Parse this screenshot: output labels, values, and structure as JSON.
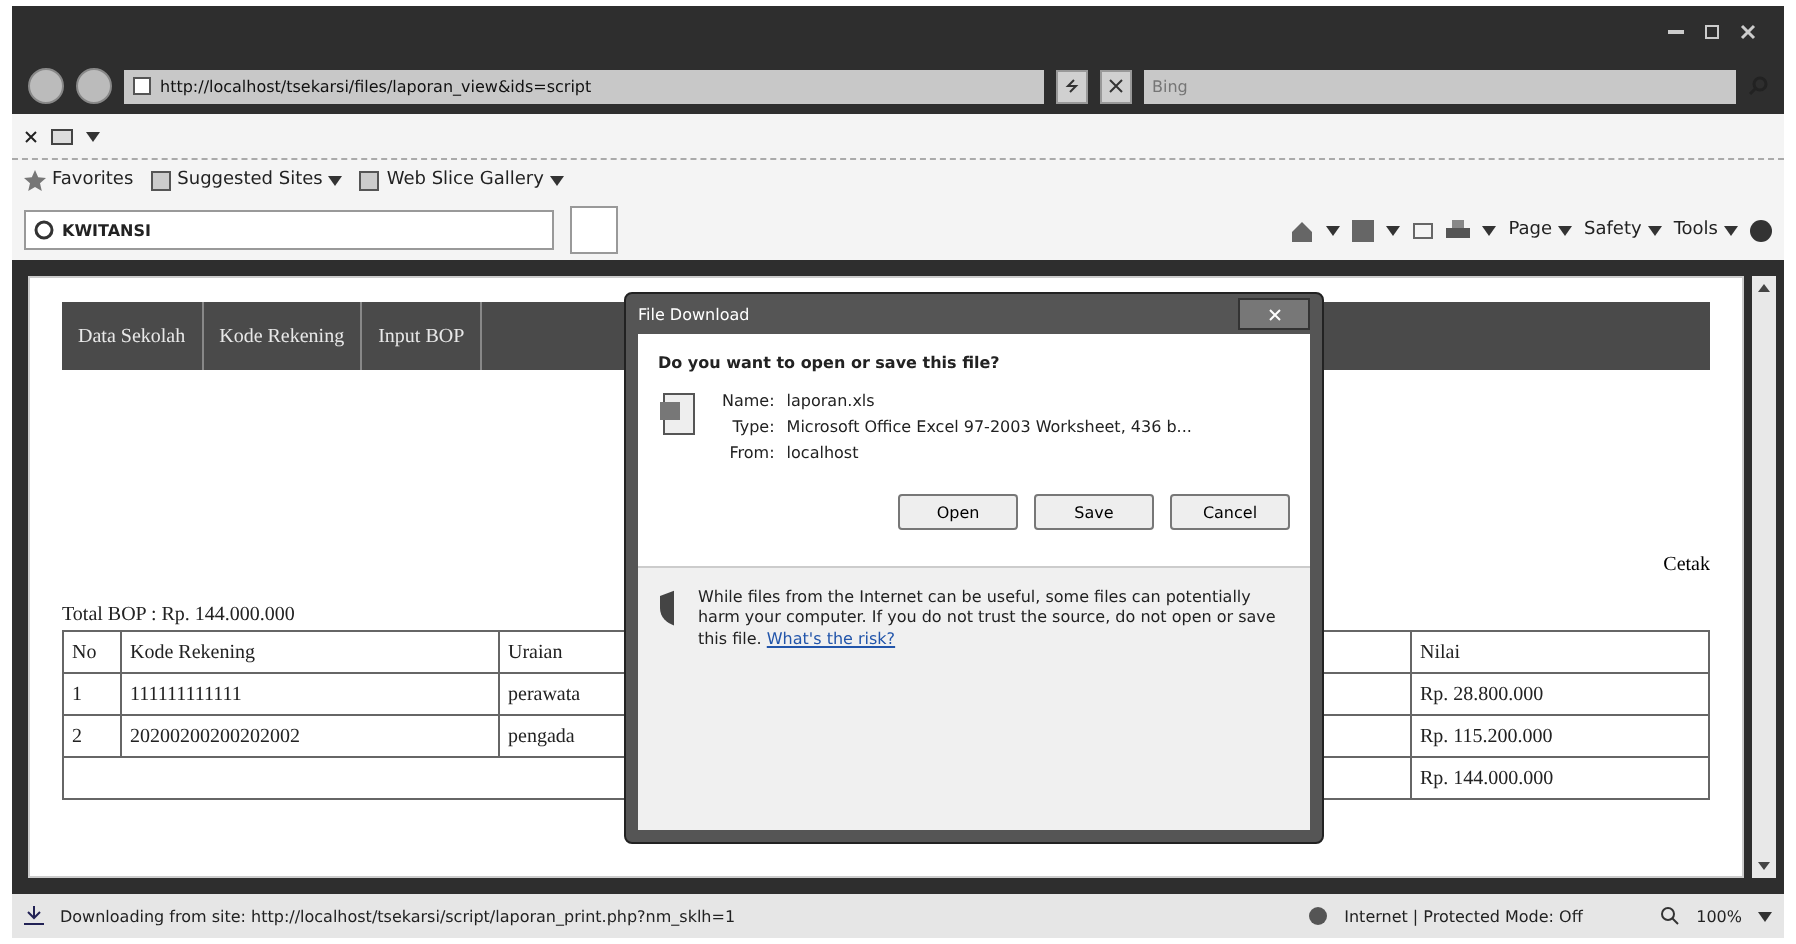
{
  "address_bar": {
    "url": "http://localhost/tsekarsi/files/laporan_view&ids=script",
    "search_placeholder": "Bing"
  },
  "favorites_bar": {
    "items": [
      {
        "label": "Favorites",
        "dropdown": false
      },
      {
        "label": "Suggested Sites",
        "dropdown": true
      },
      {
        "label": "Web Slice Gallery",
        "dropdown": true
      }
    ]
  },
  "tab": {
    "title": "KWITANSI"
  },
  "command_bar": {
    "items": [
      {
        "label": "Page",
        "dropdown": true
      },
      {
        "label": "Safety",
        "dropdown": true
      },
      {
        "label": "Tools",
        "dropdown": true
      }
    ]
  },
  "page": {
    "nav_menu": [
      "Data Sekolah",
      "Kode Rekening",
      "Input BOP"
    ],
    "print_link": "Cetak",
    "total": "Total BOP : Rp. 144.000.000",
    "table": {
      "columns": [
        "No",
        "Kode Rekening",
        "Uraian",
        "Nilai"
      ],
      "rows": [
        [
          "1",
          "111111111111",
          "perawata",
          "Rp. 28.800.000"
        ],
        [
          "2",
          "20200200200202002",
          "pengada",
          "Rp. 115.200.000"
        ]
      ],
      "footer": "Rp. 144.000.000"
    }
  },
  "dialog": {
    "title": "File Download",
    "question": "Do you want to open or save this file?",
    "fields": [
      {
        "label": "Name:",
        "value": "laporan.xls"
      },
      {
        "label": "Type:",
        "value": "Microsoft Office Excel 97-2003 Worksheet, 436 b..."
      },
      {
        "label": "From:",
        "value": "localhost"
      }
    ],
    "buttons": [
      "Open",
      "Save",
      "Cancel"
    ],
    "warning": "While files from the Internet can be useful, some files can potentially harm your computer. If you do not trust the source, do not open or save this file.",
    "risk_link": "What's the risk?"
  },
  "status_bar": {
    "message": "Downloading from site: http://localhost/tsekarsi/script/laporan_print.php?nm_sklh=1",
    "zone": "Internet | Protected Mode: Off",
    "zoom": "100%"
  }
}
